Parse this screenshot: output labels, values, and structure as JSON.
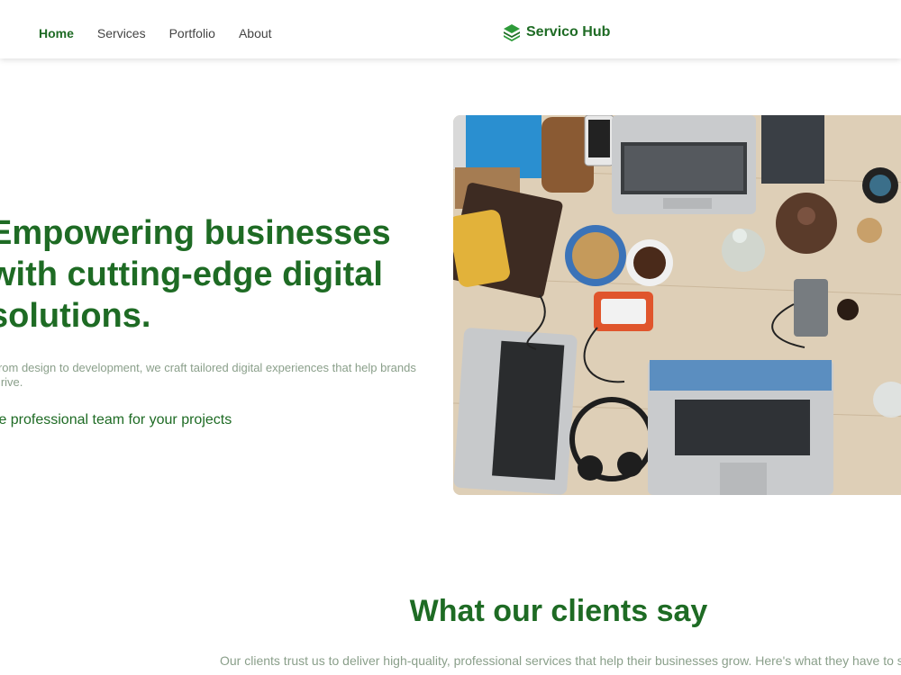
{
  "nav": {
    "links": [
      "Home",
      "Services",
      "Portfolio",
      "About"
    ],
    "active": "Home",
    "brand": "Servico Hub",
    "brand_icon": "stacked-layers-icon"
  },
  "hero": {
    "title": "Empowering businesses with cutting-edge digital solutions.",
    "description": "From design to development, we craft tailored digital experiences that help brands thrive.",
    "cta": "Hire professional team for your projects",
    "image": "workspace-desk-photo"
  },
  "testimonials": {
    "title": "What our clients say",
    "description": "Our clients trust us to deliver high-quality, professional services that help their businesses grow. Here's what they have to say:"
  },
  "colors": {
    "brand_green": "#1e6b24",
    "muted_text": "#8a9f8a",
    "nav_text": "#444444"
  }
}
